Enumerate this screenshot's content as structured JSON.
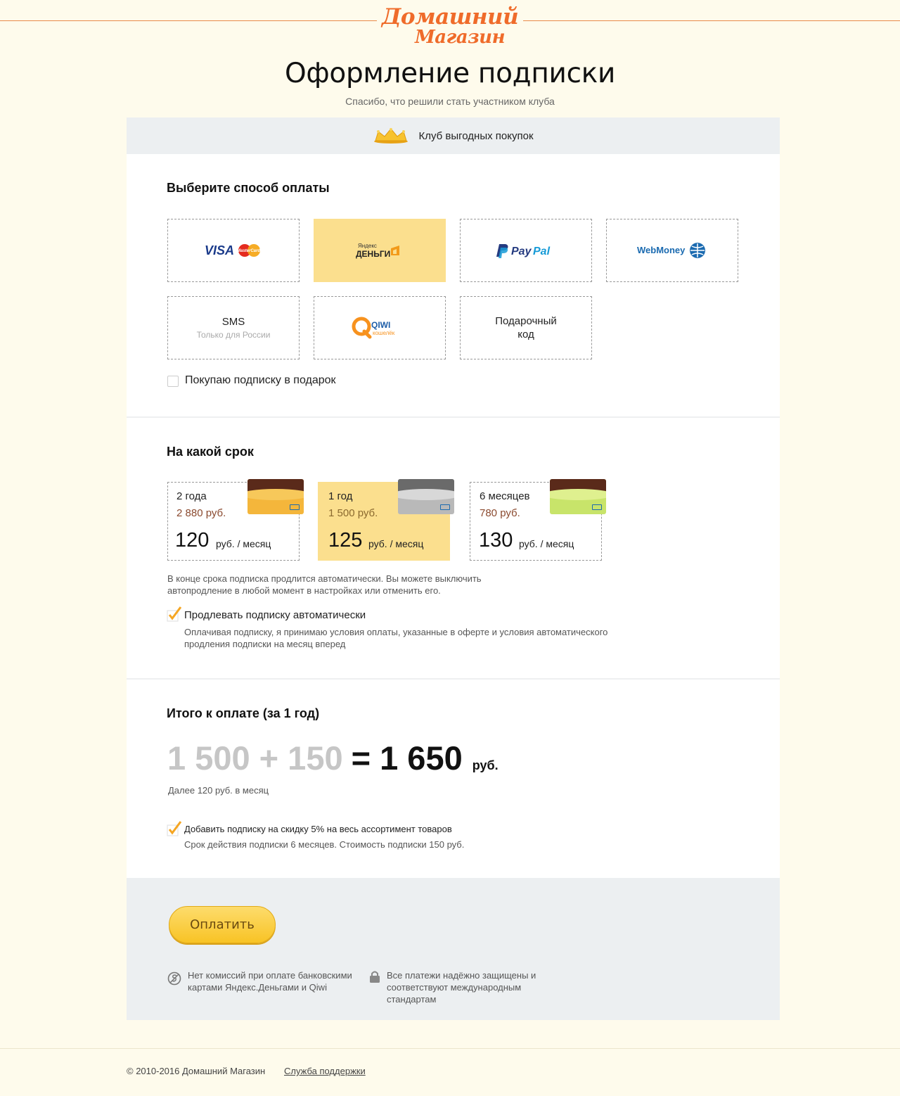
{
  "header": {
    "logo_line1": "Домашний",
    "logo_line2": "Магазин",
    "title": "Оформление подписки",
    "subtitle": "Спасибо, что решили стать участником клуба"
  },
  "club": {
    "label": "Клуб выгодных покупок"
  },
  "payment": {
    "title": "Выберите способ оплаты",
    "methods": [
      {
        "id": "visa",
        "visa_text": "VISA",
        "mc_text": "MasterCard",
        "selected": false
      },
      {
        "id": "yandex",
        "line1": "Яндекс",
        "line2": "ДЕНЬГИ",
        "selected": true
      },
      {
        "id": "paypal",
        "text_pay": "Pay",
        "text_pal": "Pal",
        "selected": false
      },
      {
        "id": "webmoney",
        "text": "WebMoney",
        "selected": false
      },
      {
        "id": "sms",
        "line1": "SMS",
        "line2": "Только для России",
        "selected": false
      },
      {
        "id": "qiwi",
        "line1": "QIWI",
        "line2": "кошелёк",
        "selected": false
      },
      {
        "id": "gift",
        "text": "Подарочный код",
        "selected": false
      }
    ],
    "gift_checkbox_label": "Покупаю подписку в подарок",
    "gift_checked": false
  },
  "term": {
    "title": "На какой срок",
    "options": [
      {
        "name": "2 года",
        "price": "2 880 руб.",
        "monthly": "120",
        "unit": "руб. / месяц",
        "card_color": "#f4b63b",
        "selected": false
      },
      {
        "name": "1 год",
        "price": "1 500 руб.",
        "monthly": "125",
        "unit": "руб. / месяц",
        "card_color": "#b9b9b9",
        "selected": true
      },
      {
        "name": "6 месяцев",
        "price": "780 руб.",
        "monthly": "130",
        "unit": "руб. / месяц",
        "card_color": "#c8e46a",
        "selected": false
      }
    ],
    "auto_note": "В конце срока подписка продлится автоматически. Вы можете выключить автопродление в любой момент в настройках или отменить его.",
    "auto_label": "Продлевать подписку автоматически",
    "auto_checked": true,
    "auto_terms": "Оплачивая подписку, я принимаю условия оплаты, указанные в оферте и условия автоматического продления подписки на месяц вперед"
  },
  "total": {
    "title": "Итого к оплате (за 1 год)",
    "formula": "1 500 + 150",
    "equals": "= 1 650",
    "unit": "руб.",
    "later": "Далее 120 руб. в месяц",
    "discount_label": "Добавить подписку на скидку 5% на весь ассортимент товаров",
    "discount_checked": true,
    "discount_note": "Срок действия подписки 6 месяцев. Стоимость подписки 150 руб."
  },
  "pay_panel": {
    "button": "Оплатить",
    "feature1": "Нет комиссий при оплате банковскими картами Яндекс.Деньгами и Qiwi",
    "feature2": "Все платежи надёжно защищены и соответствуют международным стандартам"
  },
  "footer": {
    "copyright": "© 2010-2016 Домашний Магазин",
    "support": "Служба поддержки"
  },
  "colors": {
    "accent_orange": "#ef6b2a",
    "selected_bg": "#fbdf8e",
    "page_bg": "#fefbec",
    "panel_bg": "#eceff1",
    "button": "#f8c325"
  }
}
